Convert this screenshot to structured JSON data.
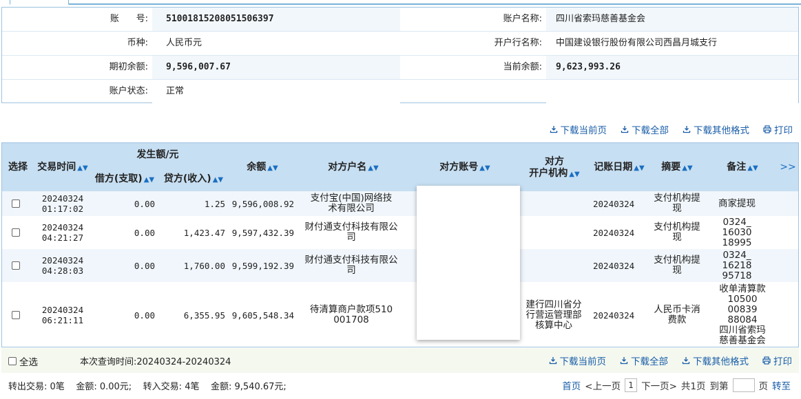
{
  "account": {
    "no_label": "账      号:",
    "no_value": "51001815208051506397",
    "name_label": "账户名称:",
    "name_value": "四川省索玛慈善基金会",
    "currency_label": "币种:",
    "currency_value": "人民币元",
    "bank_label": "开户行名称:",
    "bank_value": "中国建设银行股份有限公司西昌月城支行",
    "opening_label": "期初余额:",
    "opening_value": "9,596,007.67",
    "current_label": "当前余额:",
    "current_value": "9,623,993.26",
    "status_label": "账户状态:",
    "status_value": "正常"
  },
  "actions": {
    "download_page": "下载当前页",
    "download_all": "下载全部",
    "download_other": "下载其他格式",
    "print": "打印"
  },
  "table": {
    "headers": {
      "select": "选择",
      "time": "交易时间",
      "amount_group": "发生额/元",
      "debit": "借方(支取)",
      "credit": "贷方(收入)",
      "balance": "余额",
      "party_name": "对方户名",
      "party_account": "对方账号",
      "party_bank_l1": "对方",
      "party_bank_l2": "开户机构",
      "post_date": "记账日期",
      "summary": "摘要",
      "remark": "备注",
      "more": ">>"
    },
    "rows": [
      {
        "date": "20240324",
        "time": "01:17:02",
        "debit": "0.00",
        "credit": "1.25",
        "balance": "9,596,008.92",
        "party_l1": "支付宝(中国)网络技",
        "party_l2": "术有限公司",
        "bank_l1": "",
        "bank_l2": "",
        "bank_l3": "",
        "post": "20240324",
        "sum_l1": "支付机构提",
        "sum_l2": "现",
        "rm1": "商家提现",
        "rm2": "",
        "rm3": "",
        "rm4": "",
        "rm5": "",
        "rm6": ""
      },
      {
        "date": "20240324",
        "time": "04:21:27",
        "debit": "0.00",
        "credit": "1,423.47",
        "balance": "9,597,432.39",
        "party_l1": "财付通支付科技有限公",
        "party_l2": "司",
        "bank_l1": "",
        "bank_l2": "",
        "bank_l3": "",
        "post": "20240324",
        "sum_l1": "支付机构提",
        "sum_l2": "现",
        "rm1": "0324_",
        "rm2": "16030",
        "rm3": "18995",
        "rm4": "",
        "rm5": "",
        "rm6": ""
      },
      {
        "date": "20240324",
        "time": "04:28:03",
        "debit": "0.00",
        "credit": "1,760.00",
        "balance": "9,599,192.39",
        "party_l1": "财付通支付科技有限公",
        "party_l2": "司",
        "bank_l1": "",
        "bank_l2": "",
        "bank_l3": "",
        "post": "20240324",
        "sum_l1": "支付机构提",
        "sum_l2": "现",
        "rm1": "0324_",
        "rm2": "16218",
        "rm3": "95718",
        "rm4": "",
        "rm5": "",
        "rm6": ""
      },
      {
        "date": "20240324",
        "time": "06:21:11",
        "debit": "0.00",
        "credit": "6,355.95",
        "balance": "9,605,548.34",
        "party_l1": "待清算商户款项510",
        "party_l2": "001708",
        "bank_l1": "建行四川省分",
        "bank_l2": "行营运管理部",
        "bank_l3": "核算中心",
        "post": "20240324",
        "sum_l1": "人民币卡消",
        "sum_l2": "费款",
        "rm1": "收单清算款",
        "rm2": "10500",
        "rm3": "00839",
        "rm4": "88084",
        "rm5": "四川省索玛",
        "rm6": "慈善基金会"
      }
    ]
  },
  "footer": {
    "select_all": "全选",
    "query_time": "本次查询时间:20240324-20240324",
    "summary": "转出交易: 0笔    金额: 0.00元;    转入交易: 4笔    金额: 9,540.67元;",
    "first": "首页",
    "prev": "<上一页",
    "page": "1",
    "next": "下一页>",
    "total": "共1页",
    "goto": "到第",
    "page_unit": "页",
    "go": "转至"
  }
}
